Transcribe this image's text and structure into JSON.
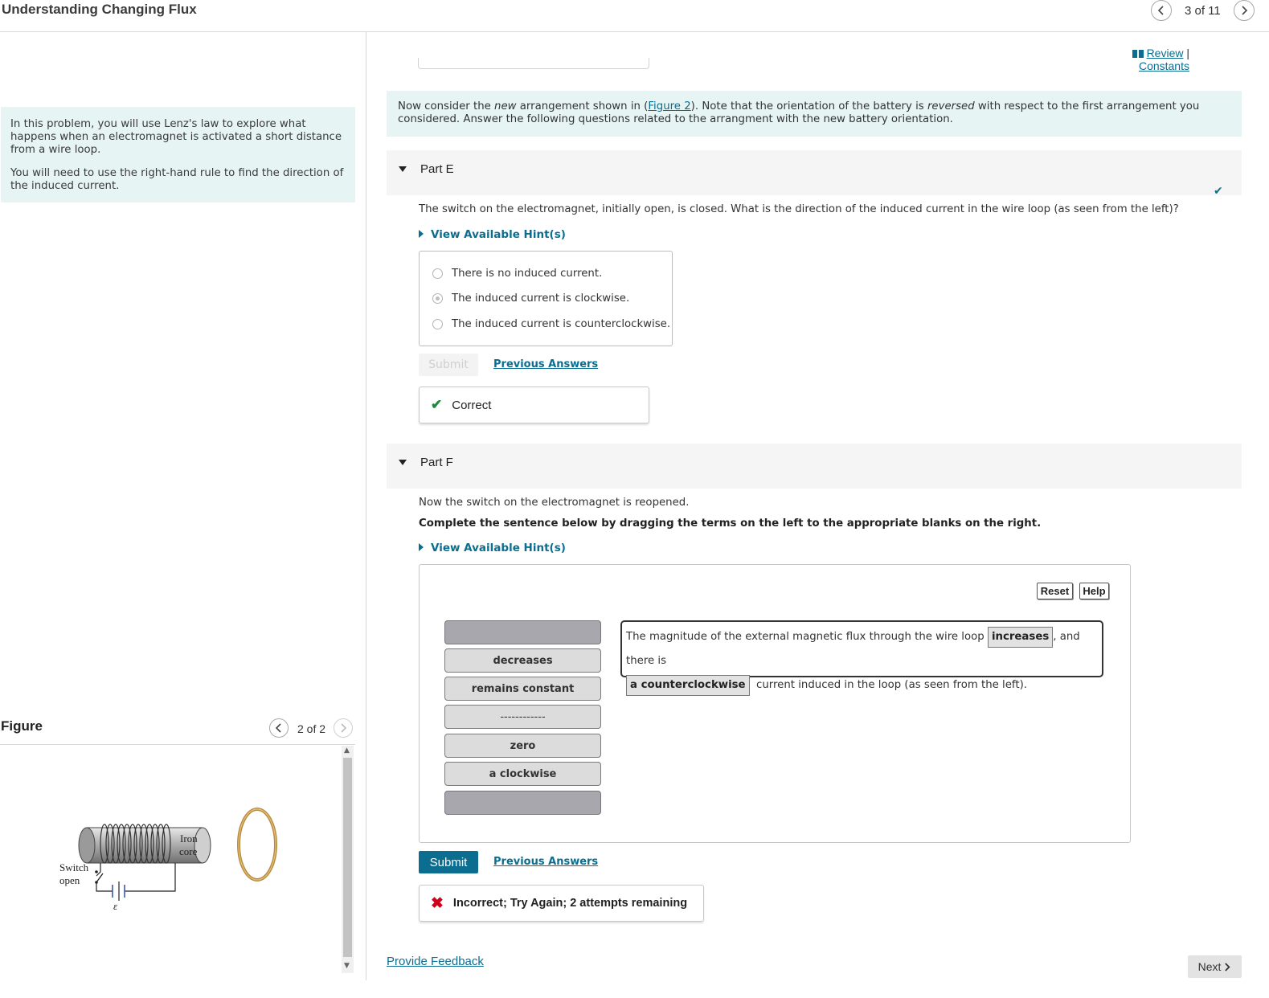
{
  "header": {
    "title": "Understanding Changing Flux",
    "counter": "3 of 11"
  },
  "intro": {
    "paragraphs": [
      "In this problem, you will use Lenz's law to explore what happens when an electromagnet is activated a short distance from a wire loop.",
      "You will need to use the right-hand rule to find the direction of the induced current."
    ]
  },
  "figure": {
    "label": "Figure",
    "counter": "2 of 2",
    "labels": {
      "iron": "Iron",
      "core": "core",
      "switch": "Switch",
      "open": "open",
      "emf": "ε"
    }
  },
  "links": {
    "review": "Review",
    "separator": "|",
    "constants": "Constants"
  },
  "banner": {
    "t1": "Now consider the ",
    "em1": "new",
    "t2": " arrangement shown in (",
    "link": "Figure 2",
    "t3": "). Note that the orientation of the battery is ",
    "em2": "reversed",
    "t4": " with respect to the first arrangement you considered. Answer the following questions related to the arrangment with the new battery orientation."
  },
  "partE": {
    "title": "Part E",
    "question": "The switch on the electromagnet, initially open, is closed. What is the direction of the induced current in the wire loop (as seen from the left)?",
    "hint": "View Available Hint(s)",
    "options": [
      "There is no induced current.",
      "The induced current is clockwise.",
      "The induced current is counterclockwise."
    ],
    "selected_index": 1,
    "submit": "Submit",
    "previous": "Previous Answers",
    "feedback": "Correct"
  },
  "partF": {
    "title": "Part F",
    "question": "Now the switch on the electromagnet is reopened.",
    "instruction": "Complete the sentence below by dragging the terms on the left to the appropriate blanks on the right.",
    "hint": "View Available Hint(s)",
    "reset": "Reset",
    "help": "Help",
    "terms": [
      "",
      "decreases",
      "remains constant",
      "------------",
      "zero",
      "a clockwise",
      ""
    ],
    "sentence": {
      "s1": "The magnitude of the external magnetic flux through the wire loop",
      "blank1": "increases",
      "s2": ", and there is",
      "blank2": "a counterclockwise",
      "s3": "current induced in the loop (as seen from the left)."
    },
    "submit": "Submit",
    "previous": "Previous Answers",
    "feedback": "Incorrect; Try Again; 2 attempts remaining"
  },
  "footer": {
    "feedback_link": "Provide Feedback",
    "next": "Next"
  },
  "colors": {
    "accent": "#0b6d8f",
    "info_bg": "#e6f4f3",
    "correct": "#1e8a3e",
    "incorrect": "#d0021b"
  }
}
